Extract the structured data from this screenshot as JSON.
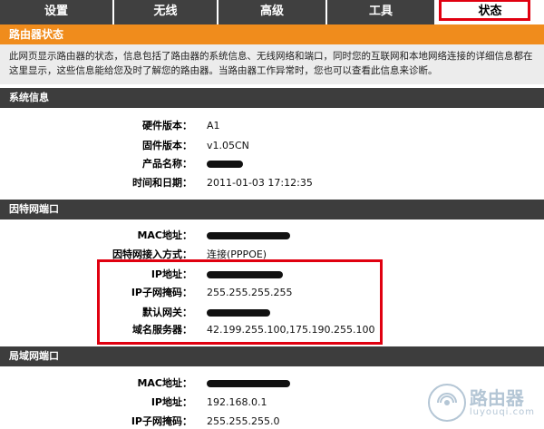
{
  "nav": {
    "tabs": [
      {
        "label": "设置"
      },
      {
        "label": "无线"
      },
      {
        "label": "高级"
      },
      {
        "label": "工具"
      },
      {
        "label": "状态"
      }
    ],
    "active_tab": "状态"
  },
  "status": {
    "title": "路由器状态",
    "description": "此网页显示路由器的状态，信息包括了路由器的系统信息、无线网络和端口，同时您的互联网和本地网络连接的详细信息都在这里显示，这些信息能给您及时了解您的路由器。当路由器工作异常时，您也可以查看此信息来诊断。"
  },
  "system_info": {
    "header": "系统信息",
    "rows": [
      {
        "label": "硬件版本：",
        "value": "A1"
      },
      {
        "label": "固件版本：",
        "value": "v1.05CN"
      },
      {
        "label": "产品名称：",
        "value": ""
      },
      {
        "label": "时间和日期：",
        "value": "2011-01-03 17:12:35"
      }
    ]
  },
  "internet_port": {
    "header": "因特网端口",
    "rows": [
      {
        "label": "MAC地址：",
        "value": ""
      },
      {
        "label": "因特网接入方式：",
        "value": "连接(PPPOE)"
      },
      {
        "label": "IP地址：",
        "value": ""
      },
      {
        "label": "IP子网掩码：",
        "value": "255.255.255.255"
      },
      {
        "label": "默认网关：",
        "value": ""
      },
      {
        "label": "域名服务器：",
        "value": "42.199.255.100,175.190.255.100"
      }
    ]
  },
  "lan_port": {
    "header": "局域网端口",
    "rows": [
      {
        "label": "MAC地址：",
        "value": ""
      },
      {
        "label": "IP地址：",
        "value": "192.168.0.1"
      },
      {
        "label": "IP子网掩码：",
        "value": "255.255.255.0"
      }
    ]
  },
  "watermark": {
    "name": "路由器",
    "url": "luyouqi.com"
  },
  "colors": {
    "highlight": "#e00010",
    "status_header": "#f08c1c",
    "section_header": "#3d3d3d"
  }
}
